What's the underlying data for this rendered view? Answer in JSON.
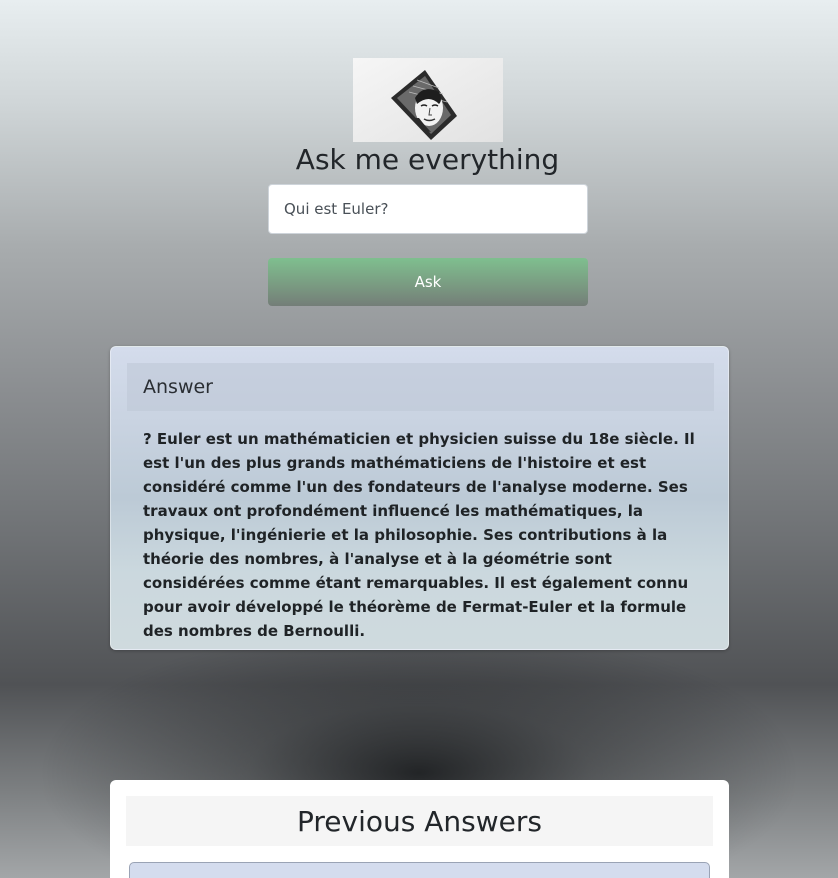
{
  "header": {
    "logo_icon": "portrait-drawing-icon",
    "title": "Ask me everything"
  },
  "question": {
    "value": "Qui est Euler?"
  },
  "ask_button": {
    "label": "Ask",
    "color": "#7fbf8f"
  },
  "answer": {
    "header": "Answer",
    "text": "? Euler est un mathématicien et physicien suisse du 18e siècle. Il est l'un des plus grands mathématiciens de l'histoire et est considéré comme l'un des fondateurs de l'analyse moderne. Ses travaux ont profondément influencé les mathématiques, la physique, l'ingénierie et la philosophie. Ses contributions à la théorie des nombres, à l'analyse et à la géométrie sont considérées comme étant remarquables. Il est également connu pour avoir développé le théorème de Fermat-Euler et la formule des nombres de Bernoulli."
  },
  "previous": {
    "header": "Previous Answers"
  }
}
